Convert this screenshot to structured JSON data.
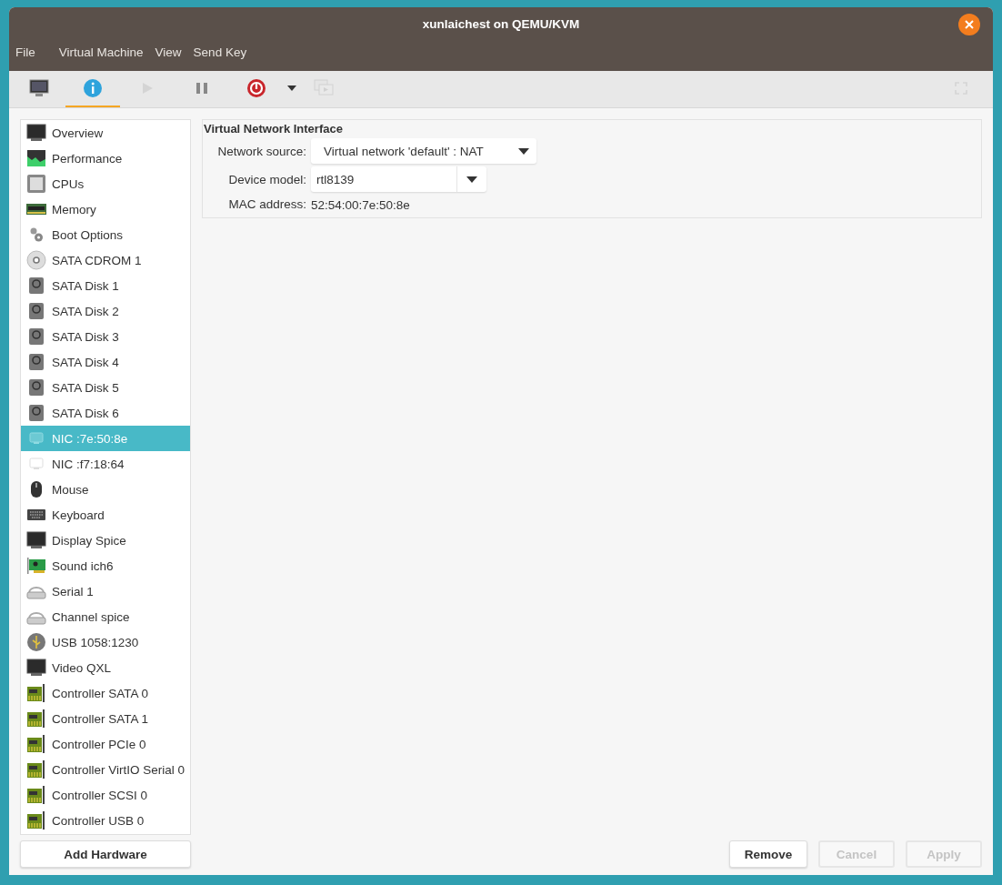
{
  "window": {
    "title": "xunlaichest on QEMU/KVM"
  },
  "menu": [
    "File",
    "Virtual Machine",
    "View",
    "Send Key"
  ],
  "toolbar": [
    {
      "kind": "console",
      "selected": false,
      "disabled": false
    },
    {
      "kind": "details",
      "selected": true,
      "disabled": false
    },
    {
      "kind": "run",
      "selected": false,
      "disabled": true
    },
    {
      "kind": "pause",
      "selected": false,
      "disabled": false
    },
    {
      "kind": "shutdown",
      "selected": false,
      "disabled": false
    },
    {
      "kind": "dropdown",
      "selected": false,
      "disabled": false
    },
    {
      "kind": "snapshots",
      "selected": false,
      "disabled": true
    },
    {
      "kind": "fullscreen",
      "selected": false,
      "disabled": true
    }
  ],
  "sidebar": {
    "items": [
      {
        "label": "Overview",
        "kind": "monitor",
        "selected": false
      },
      {
        "label": "Performance",
        "kind": "chart",
        "selected": false
      },
      {
        "label": "CPUs",
        "kind": "chip",
        "selected": false
      },
      {
        "label": "Memory",
        "kind": "memory",
        "selected": false
      },
      {
        "label": "Boot Options",
        "kind": "gears",
        "selected": false
      },
      {
        "label": "SATA CDROM 1",
        "kind": "disc",
        "selected": false
      },
      {
        "label": "SATA Disk 1",
        "kind": "disk",
        "selected": false
      },
      {
        "label": "SATA Disk 2",
        "kind": "disk",
        "selected": false
      },
      {
        "label": "SATA Disk 3",
        "kind": "disk",
        "selected": false
      },
      {
        "label": "SATA Disk 4",
        "kind": "disk",
        "selected": false
      },
      {
        "label": "SATA Disk 5",
        "kind": "disk",
        "selected": false
      },
      {
        "label": "SATA Disk 6",
        "kind": "disk",
        "selected": false
      },
      {
        "label": "NIC :7e:50:8e",
        "kind": "nic",
        "selected": true
      },
      {
        "label": "NIC :f7:18:64",
        "kind": "nic",
        "selected": false
      },
      {
        "label": "Mouse",
        "kind": "mouse",
        "selected": false
      },
      {
        "label": "Keyboard",
        "kind": "keyboard",
        "selected": false
      },
      {
        "label": "Display Spice",
        "kind": "monitor",
        "selected": false
      },
      {
        "label": "Sound ich6",
        "kind": "sound",
        "selected": false
      },
      {
        "label": "Serial 1",
        "kind": "serial",
        "selected": false
      },
      {
        "label": "Channel spice",
        "kind": "serial",
        "selected": false
      },
      {
        "label": "USB 1058:1230",
        "kind": "usb",
        "selected": false
      },
      {
        "label": "Video QXL",
        "kind": "monitor",
        "selected": false
      },
      {
        "label": "Controller SATA 0",
        "kind": "controller",
        "selected": false
      },
      {
        "label": "Controller SATA 1",
        "kind": "controller",
        "selected": false
      },
      {
        "label": "Controller PCIe 0",
        "kind": "controller",
        "selected": false
      },
      {
        "label": "Controller VirtIO Serial 0",
        "kind": "controller",
        "selected": false
      },
      {
        "label": "Controller SCSI 0",
        "kind": "controller",
        "selected": false
      },
      {
        "label": "Controller USB 0",
        "kind": "controller",
        "selected": false
      }
    ],
    "add_button": "Add Hardware"
  },
  "details": {
    "title": "Virtual Network Interface",
    "network_source": {
      "label": "Network source:",
      "value": "Virtual network 'default' : NAT"
    },
    "device_model": {
      "label": "Device model:",
      "value": "rtl8139"
    },
    "mac": {
      "label": "MAC address:",
      "value": "52:54:00:7e:50:8e"
    }
  },
  "buttons": [
    {
      "label": "Remove",
      "disabled": false
    },
    {
      "label": "Cancel",
      "disabled": true
    },
    {
      "label": "Apply",
      "disabled": true
    }
  ]
}
